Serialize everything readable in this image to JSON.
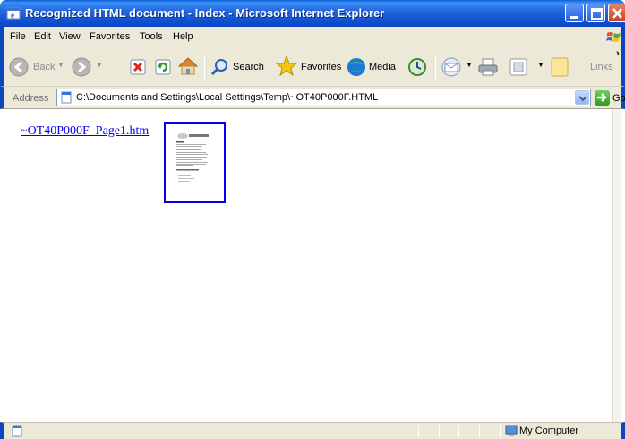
{
  "window": {
    "title": "Recognized HTML document - Index - Microsoft Internet Explorer"
  },
  "menu": {
    "items": [
      "File",
      "Edit",
      "View",
      "Favorites",
      "Tools",
      "Help"
    ]
  },
  "toolbar": {
    "back_label": "Back",
    "search_label": "Search",
    "favorites_label": "Favorites",
    "media_label": "Media",
    "links_label": "Links"
  },
  "address": {
    "label": "Address",
    "value": "C:\\Documents and Settings\\Local Settings\\Temp\\~OT40P000F.HTML",
    "go_label": "Go"
  },
  "content": {
    "link_text": "~OT40P000F_Page1.htm"
  },
  "status": {
    "zone_label": "My Computer"
  },
  "icons": {
    "back": "back-arrow-icon",
    "forward": "forward-arrow-icon",
    "stop": "stop-icon",
    "refresh": "refresh-icon",
    "home": "home-icon",
    "search": "search-icon",
    "favorites": "favorites-star-icon",
    "media": "media-icon",
    "history": "history-icon",
    "mail": "mail-icon",
    "print": "print-icon",
    "edit": "edit-icon",
    "messenger": "messenger-icon"
  }
}
